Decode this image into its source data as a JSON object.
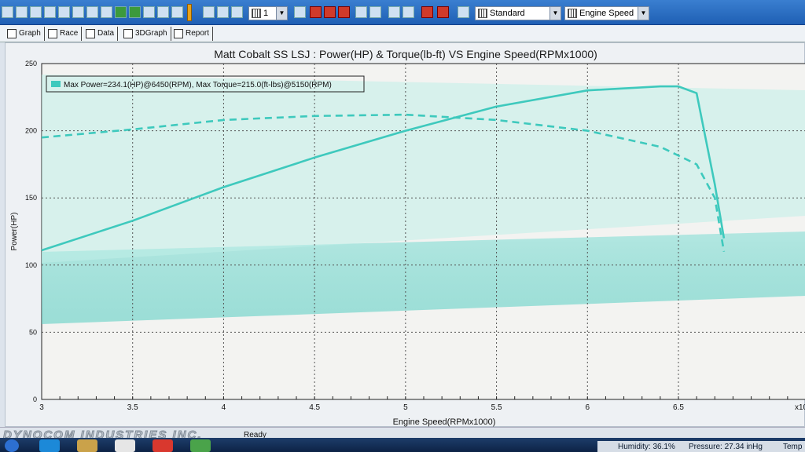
{
  "toolbar": {
    "zoom_value": "1",
    "mode_select": "Standard",
    "axis_select": "Engine Speed"
  },
  "tabs": [
    {
      "label": "Graph"
    },
    {
      "label": "Race"
    },
    {
      "label": "Data"
    },
    {
      "label": "3DGraph"
    },
    {
      "label": "Report"
    }
  ],
  "chart_data": {
    "type": "line",
    "title": "Matt Cobalt SS LSJ : Power(HP) & Torque(lb-ft) VS Engine Speed(RPMx1000)",
    "xlabel": "Engine Speed(RPMx1000)",
    "ylabel": "Power(HP)",
    "xlim": [
      3.0,
      7.2
    ],
    "ylim": [
      0,
      250
    ],
    "xticks": [
      "3",
      "3.5",
      "4",
      "4.5",
      "5",
      "5.5",
      "6",
      "6.5",
      "x10"
    ],
    "yticks": [
      "0",
      "50",
      "100",
      "150",
      "200",
      "250"
    ],
    "grid": true,
    "legend_position": "top-left",
    "legend_text": "Max Power=234.1(HP)@6450(RPM), Max Torque=215.0(ft-lbs)@5150(RPM)",
    "series": [
      {
        "style": "solid",
        "color": "#3ec9bd",
        "x": [
          3.0,
          3.5,
          4.0,
          4.5,
          5.0,
          5.5,
          6.0,
          6.4,
          6.5,
          6.6,
          6.7,
          6.75
        ],
        "y": [
          111,
          133,
          158,
          180,
          200,
          218,
          230,
          233,
          233,
          228,
          160,
          120
        ]
      },
      {
        "style": "dashed",
        "color": "#3ec9bd",
        "x": [
          3.0,
          3.5,
          4.0,
          4.5,
          5.0,
          5.5,
          6.0,
          6.4,
          6.6,
          6.7,
          6.75
        ],
        "y": [
          195,
          201,
          208,
          211,
          212,
          208,
          200,
          188,
          175,
          150,
          110
        ]
      }
    ]
  },
  "status": {
    "brand": "DYNOCOM INDUSTRIES INC.",
    "text": "Ready",
    "humidity": "Humidity: 36.1%",
    "pressure": "Pressure: 27.34 inHg",
    "temp": "Temp"
  },
  "colors": {
    "accent": "#3ec9bd",
    "toolbar": "#2a6fc4"
  }
}
